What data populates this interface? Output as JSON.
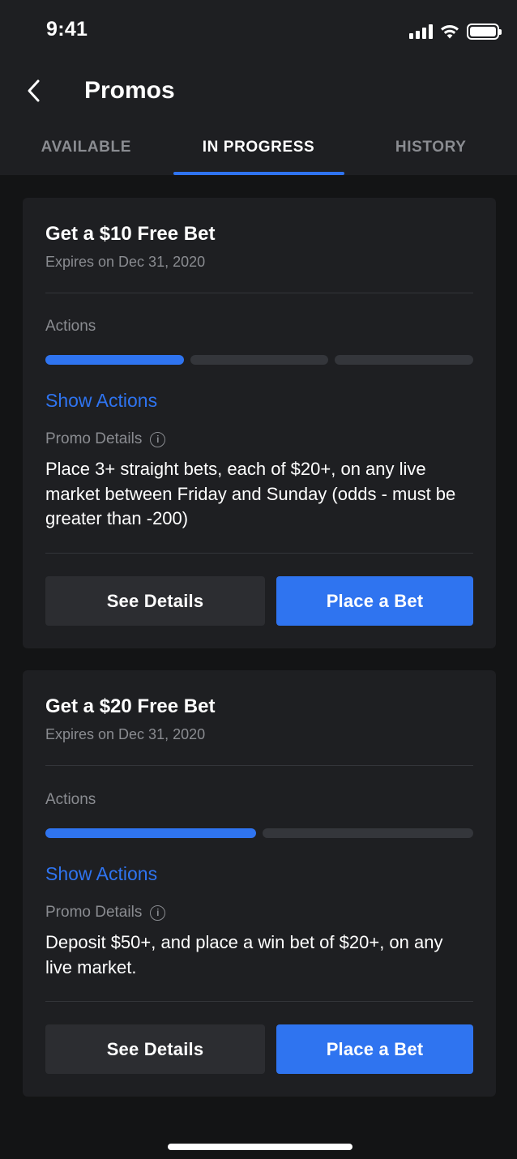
{
  "status_bar": {
    "time": "9:41",
    "icons": [
      "cellular-signal-icon",
      "wifi-icon",
      "battery-icon"
    ]
  },
  "header": {
    "title": "Promos",
    "back_icon": "chevron-left-icon"
  },
  "tabs": [
    {
      "label": "AVAILABLE",
      "active": false
    },
    {
      "label": "IN PROGRESS",
      "active": true
    },
    {
      "label": "HISTORY",
      "active": false
    }
  ],
  "promos": [
    {
      "title": "Get a $10 Free Bet",
      "expiry": "Expires on Dec 31, 2020",
      "actions_label": "Actions",
      "progress": {
        "completed": 1,
        "total": 3
      },
      "show_actions_label": "Show Actions",
      "details_label": "Promo Details",
      "description": "Place 3+ straight bets, each of $20+, on any live market between Friday and Sunday (odds - must be greater than -200)",
      "see_details_label": "See Details",
      "place_bet_label": "Place a Bet"
    },
    {
      "title": "Get a $20 Free Bet",
      "expiry": "Expires on Dec 31, 2020",
      "actions_label": "Actions",
      "progress": {
        "completed": 1,
        "total": 2
      },
      "show_actions_label": "Show Actions",
      "details_label": "Promo Details",
      "description": "Deposit $50+, and place a win bet of $20+, on any live market.",
      "see_details_label": "See Details",
      "place_bet_label": "Place a Bet"
    }
  ],
  "colors": {
    "background": "#131415",
    "surface": "#1e1f22",
    "accent": "#2f74f0",
    "muted_text": "#8a8c91",
    "secondary_button": "#2c2d31"
  }
}
